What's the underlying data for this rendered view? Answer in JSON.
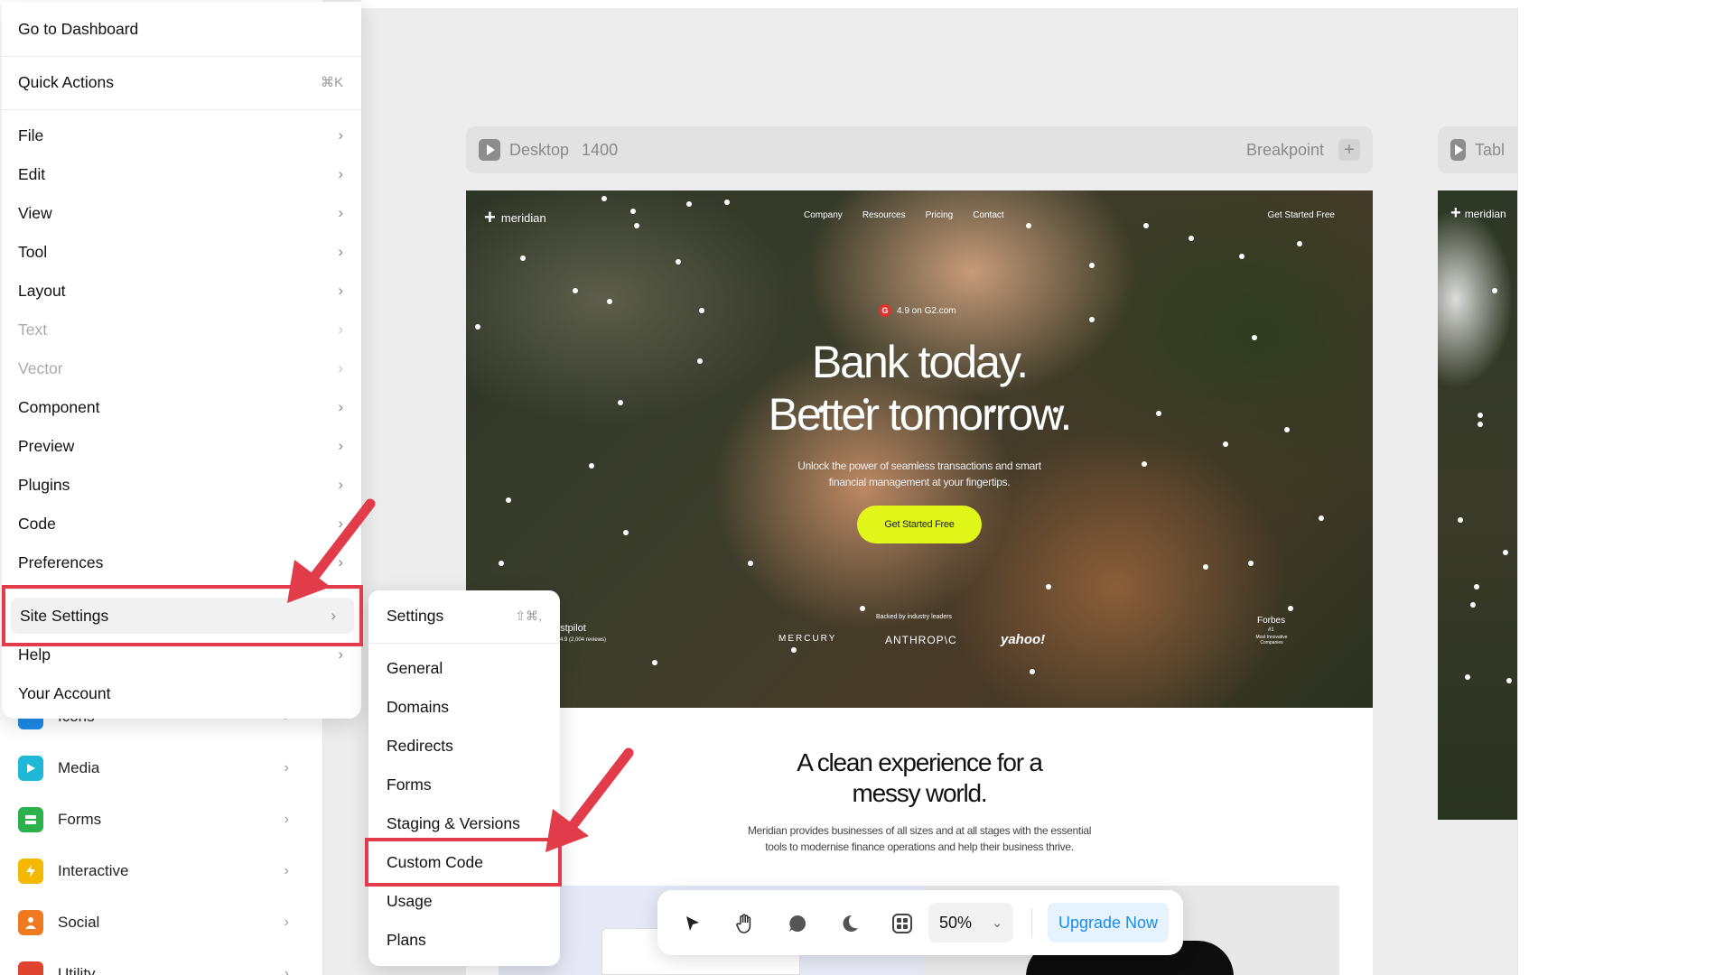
{
  "menu": {
    "go_to_dashboard": "Go to Dashboard",
    "quick_actions": "Quick Actions",
    "quick_actions_shortcut": "⌘K",
    "items": [
      "File",
      "Edit",
      "View",
      "Tool",
      "Layout",
      "Text",
      "Vector",
      "Component",
      "Preview",
      "Plugins",
      "Code",
      "Preferences"
    ],
    "site_settings": "Site Settings",
    "help": "Help",
    "your_account": "Your Account"
  },
  "submenu": {
    "settings": "Settings",
    "settings_shortcut": "⇧⌘,",
    "items": [
      "General",
      "Domains",
      "Redirects",
      "Forms",
      "Staging & Versions"
    ],
    "custom_code": "Custom Code",
    "usage": "Usage",
    "plans": "Plans"
  },
  "insert_panel": {
    "items": [
      "Icons",
      "Media",
      "Forms",
      "Interactive",
      "Social",
      "Utility"
    ],
    "colors": [
      "#1c8ce8",
      "#1fb8d6",
      "#2bb24c",
      "#f5b800",
      "#f07a1f",
      "#e0442f"
    ]
  },
  "frame_desktop": {
    "name": "Desktop",
    "width": "1400",
    "breakpoint": "Breakpoint"
  },
  "frame_tablet": {
    "name": "Tabl"
  },
  "hero": {
    "logo": "meridian",
    "nav": [
      "Company",
      "Resources",
      "Pricing",
      "Contact"
    ],
    "cta_top": "Get Started Free",
    "rating": "4.9 on G2.com",
    "headline_1": "Bank today.",
    "headline_2": "Better tomorrow.",
    "sub_1": "Unlock the power of seamless transactions and smart",
    "sub_2": "financial management at your fingertips.",
    "cta": "Get Started Free",
    "trustpilot": "Trustpilot",
    "trustpilot_reviews": "4.9 (2,004 reviews)",
    "backed_by": "Backed by industry leaders",
    "logo_mercury": "MERCURY",
    "logo_anthropic": "ANTHROP\\C",
    "logo_yahoo": "yahoo!",
    "forbes": "Forbes",
    "forbes_rank": "#1",
    "forbes_sub": "Most Innovative Companies"
  },
  "content": {
    "heading_1": "A clean experience for a",
    "heading_2": "messy world.",
    "para_1": "Meridian provides businesses of all sizes and at all stages with the essential",
    "para_2": "tools to modernise finance operations and help their business thrive."
  },
  "tablet_logo": "meridian",
  "toolbar": {
    "zoom": "50%",
    "upgrade": "Upgrade Now"
  },
  "colors": {
    "highlight_red": "#e23b4a",
    "upgrade_blue": "#1c8ce8",
    "hero_button": "#e1f71a"
  }
}
